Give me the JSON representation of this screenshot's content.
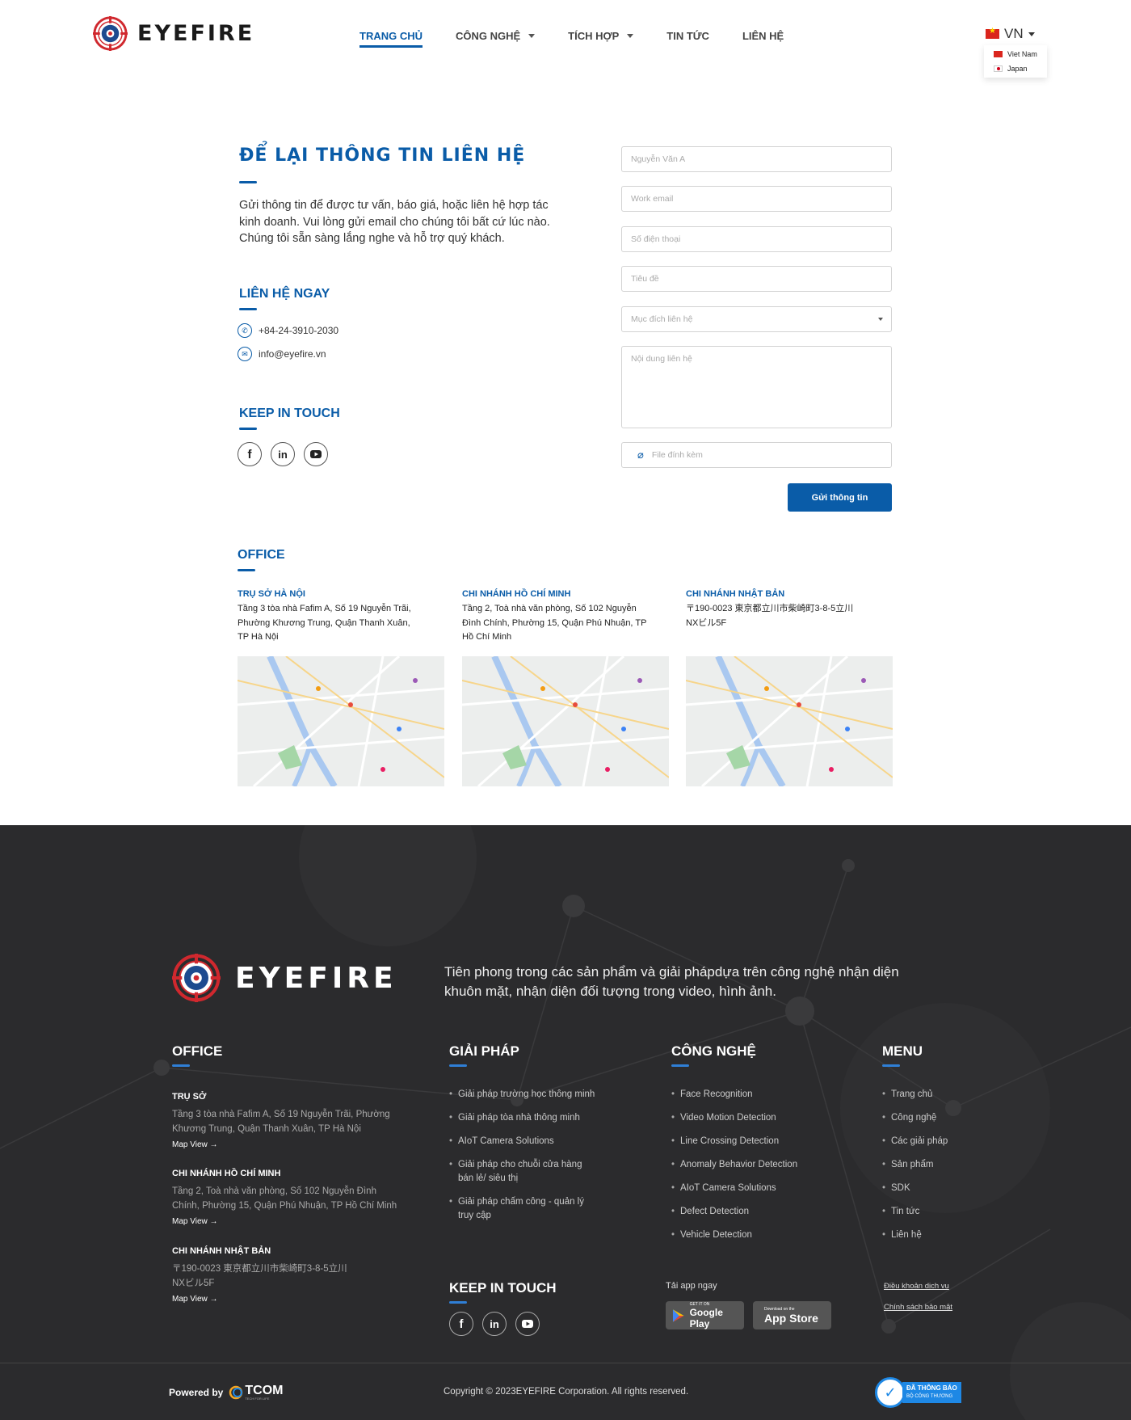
{
  "brand": {
    "name": "EYEFIRE"
  },
  "nav": {
    "items": [
      {
        "label": "TRANG CHỦ"
      },
      {
        "label": "CÔNG NGHỆ"
      },
      {
        "label": "TÍCH HỢP"
      },
      {
        "label": "TIN TỨC"
      },
      {
        "label": "LIÊN HỆ"
      }
    ]
  },
  "language": {
    "current": "VN",
    "options": [
      "Viet Nam",
      "Japan"
    ]
  },
  "contact": {
    "title": "ĐỂ LẠI THÔNG TIN LIÊN HỆ",
    "description": "Gửi thông tin để được tư vấn, báo giá, hoặc liên hệ hợp tác kinh doanh. Vui lòng gửi email cho chúng tôi bất cứ lúc nào. Chúng tôi sẵn sàng lắng nghe và hỗ trợ quý khách.",
    "contact_now_heading": "LIÊN HỆ NGAY",
    "phone": "+84-24-3910-2030",
    "email": "info@eyefire.vn",
    "keep_in_touch_heading": "KEEP IN TOUCH"
  },
  "form": {
    "name_placeholder": "Nguyễn Văn A",
    "email_placeholder": "Work email",
    "phone_placeholder": "Số điện thoại",
    "subject_placeholder": "Tiêu đề",
    "purpose_placeholder": "Mục đích liên hệ",
    "message_placeholder": "Nội dung liên hệ",
    "attachment_placeholder": "File đính kèm",
    "submit_label": "Gửi thông tin"
  },
  "office": {
    "heading": "OFFICE",
    "locations": [
      {
        "name": "TRỤ SỞ HÀ NỘI",
        "address": "Tầng 3 tòa nhà Fafim A, Số 19 Nguyễn Trãi, Phường Khương Trung, Quận Thanh Xuân, TP Hà Nội"
      },
      {
        "name": "CHI NHÁNH HỒ CHÍ MINH",
        "address": "Tầng 2, Toà nhà văn phòng, Số 102 Nguyễn Đình Chính, Phường 15, Quận Phú Nhuận, TP Hồ Chí Minh"
      },
      {
        "name": "CHI NHÁNH NHẬT BẢN",
        "address": "〒190-0023 東京都立川市柴崎町3-8-5立川NXビル5F"
      }
    ]
  },
  "footer": {
    "tagline": "Tiên phong trong các sản phẩm và giải phápdựa trên công nghệ nhận diện khuôn mặt, nhận diện đối tượng trong video, hình ảnh.",
    "office_heading": "OFFICE",
    "offices": [
      {
        "name": "TRỤ SỞ",
        "address": "Tầng 3 tòa nhà Fafim A, Số 19 Nguyễn Trãi, Phường Khương Trung, Quận Thanh Xuân, TP Hà Nội",
        "map_view": "Map View"
      },
      {
        "name": "CHI NHÁNH HỒ CHÍ MINH",
        "address": "Tầng 2, Toà nhà văn phòng, Số 102 Nguyễn Đình Chính, Phường 15, Quận Phú Nhuận, TP Hồ Chí Minh",
        "map_view": "Map View"
      },
      {
        "name": "CHI NHÁNH NHẬT BẢN",
        "address": "〒190-0023 東京都立川市柴崎町3-8-5立川NXビル5F",
        "map_view": "Map View"
      }
    ],
    "solutions_heading": "GIẢI PHÁP",
    "solutions": [
      "Giải pháp trường học thông minh",
      "Giải pháp tòa nhà thông minh",
      "AIoT Camera Solutions",
      "Giải pháp cho chuỗi cửa hàng bán lẻ/ siêu thị",
      "Giải pháp chấm công - quản lý truy cập"
    ],
    "tech_heading": "CÔNG NGHỆ",
    "tech": [
      "Face Recognition",
      "Video Motion Detection",
      "Line Crossing Detection",
      "Anomaly Behavior Detection",
      "AIoT Camera Solutions",
      "Defect Detection",
      "Vehicle Detection"
    ],
    "menu_heading": "MENU",
    "menu": [
      "Trang chủ",
      "Công nghệ",
      "Các giải pháp",
      "Sản phẩm",
      "SDK",
      "Tin tức",
      "Liên hệ"
    ],
    "keep_in_touch_heading": "KEEP IN TOUCH",
    "app_heading": "Tải app ngay",
    "google_play_small": "GET IT ON",
    "google_play_big": "Google Play",
    "app_store_small": "Download on the",
    "app_store_big": "App Store",
    "terms": "Điều khoản dịch vụ",
    "privacy": "Chính sách bảo mật",
    "powered_by": "Powered by",
    "powered_brand": "TCOM",
    "powered_brand_tag": "TECH FOR LIFE",
    "copyright": "Copyright © 2023EYEFIRE Corporation. All rights reserved.",
    "badge_line1": "ĐÃ THÔNG BÁO",
    "badge_line2": "BỘ CÔNG THƯƠNG"
  },
  "colors": {
    "primary": "#0a5ca8",
    "footer_bg": "#2b2b2d",
    "accent_blue": "#2f7fd6",
    "logo_red": "#d0282e"
  }
}
